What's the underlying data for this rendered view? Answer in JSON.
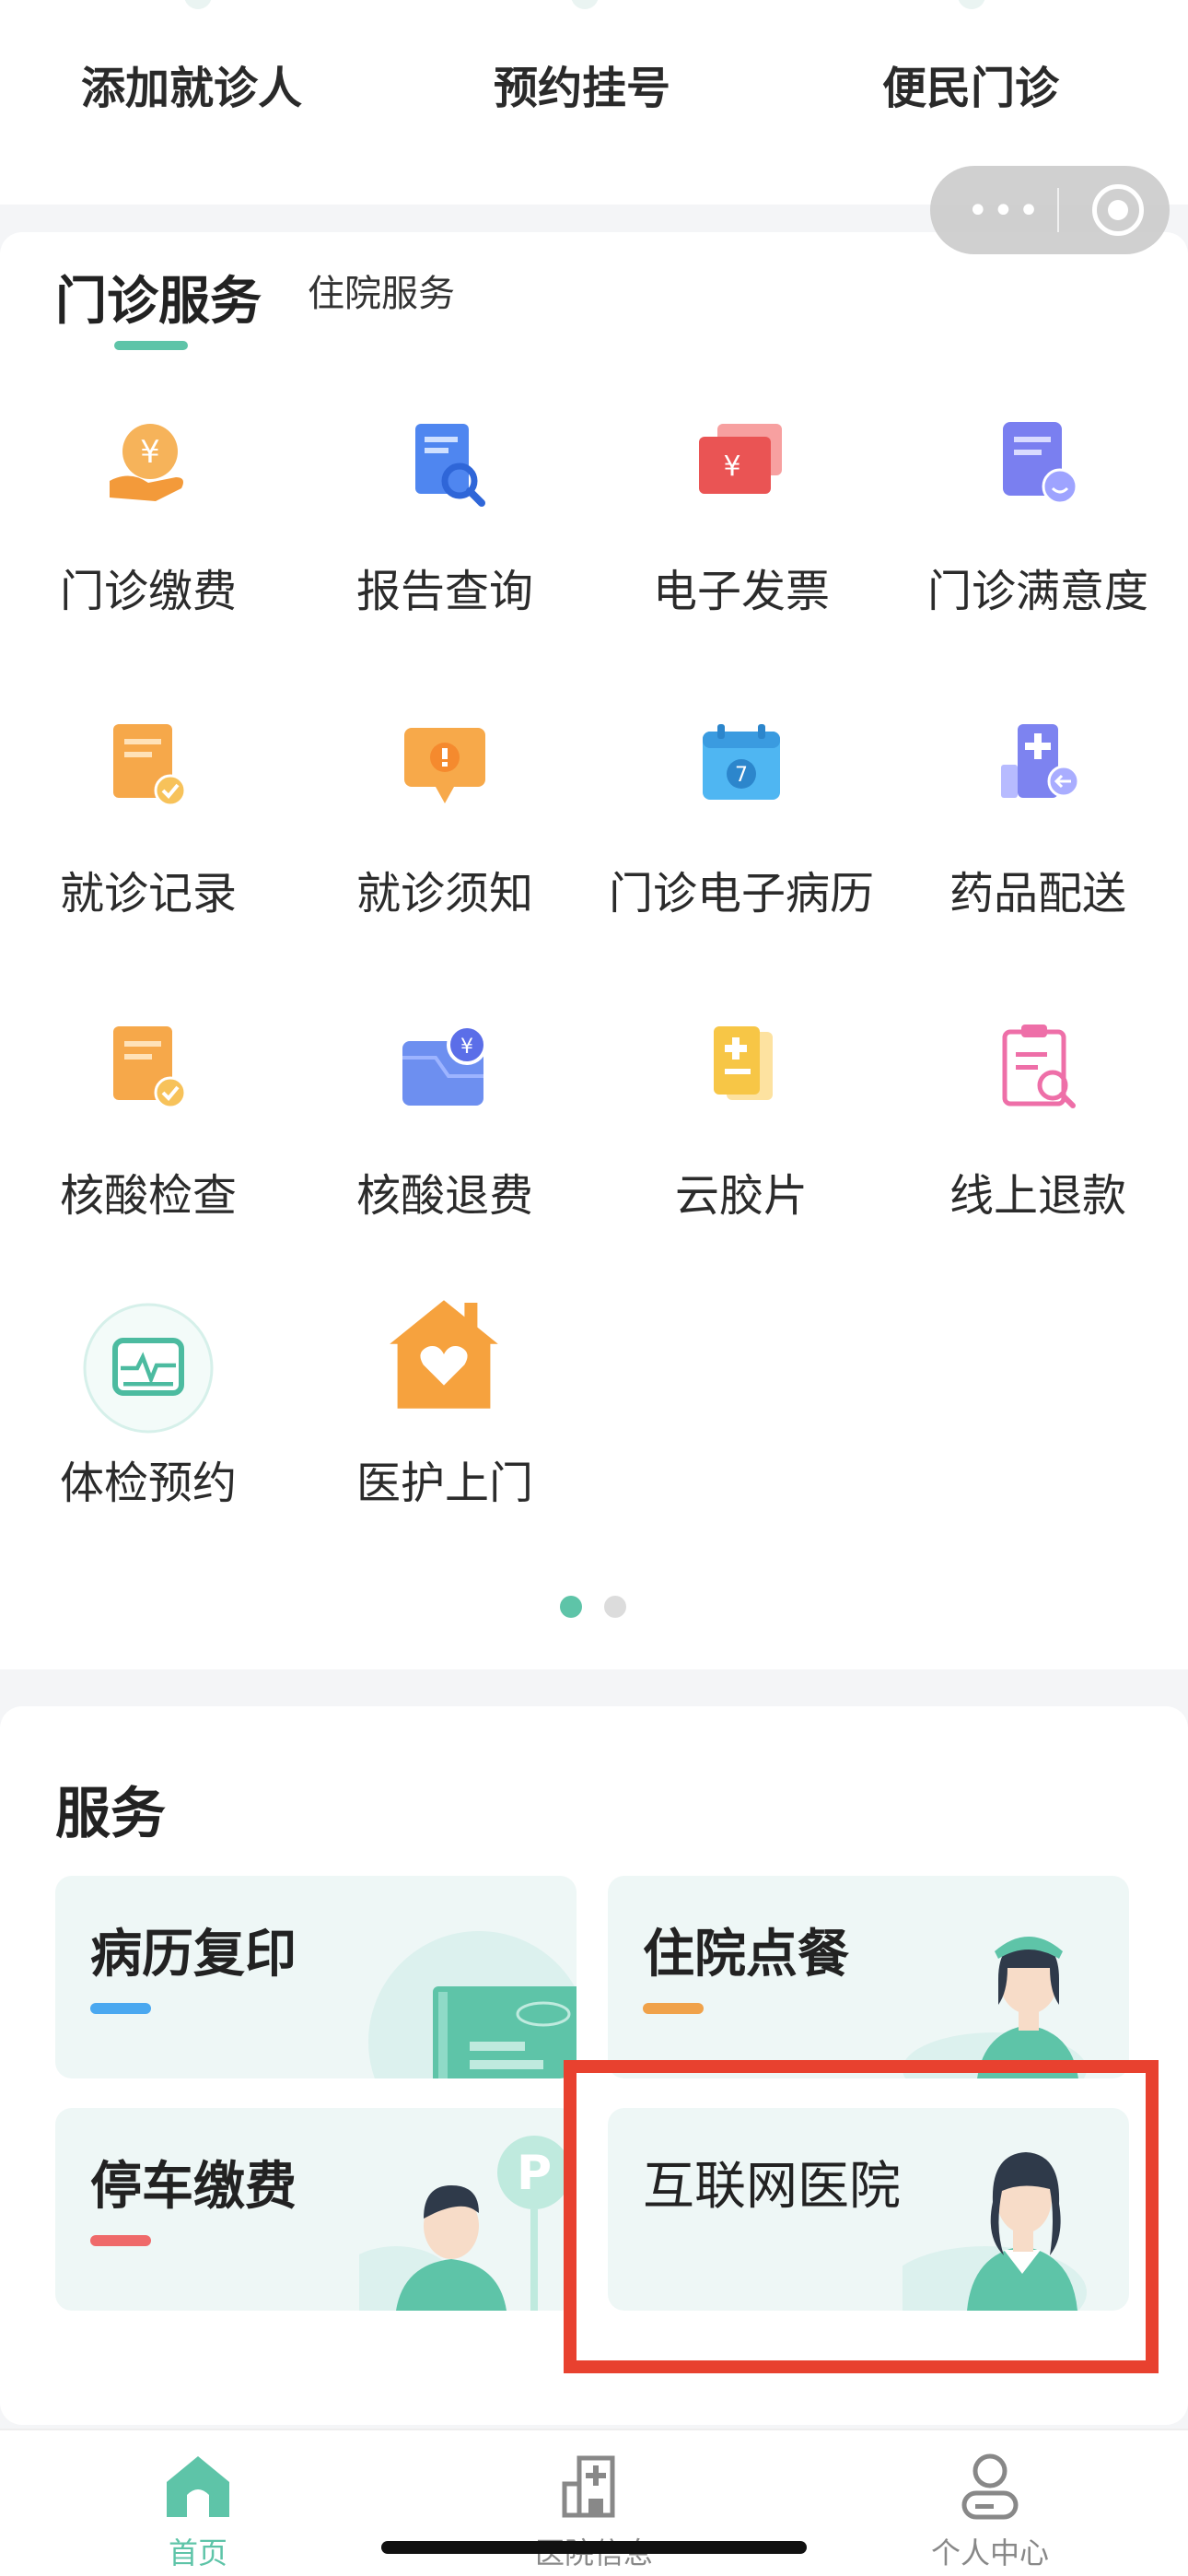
{
  "top_actions": [
    "添加就诊人",
    "预约挂号",
    "便民门诊"
  ],
  "tabs": {
    "active": "门诊服务",
    "inactive": "住院服务"
  },
  "grid": [
    {
      "label": "门诊缴费",
      "icon": "payment-hand-icon"
    },
    {
      "label": "报告查询",
      "icon": "report-search-icon"
    },
    {
      "label": "电子发票",
      "icon": "e-invoice-icon"
    },
    {
      "label": "门诊满意度",
      "icon": "satisfaction-icon"
    },
    {
      "label": "就诊记录",
      "icon": "visit-record-icon"
    },
    {
      "label": "就诊须知",
      "icon": "notice-icon"
    },
    {
      "label": "门诊电子病历",
      "icon": "calendar-record-icon"
    },
    {
      "label": "药品配送",
      "icon": "medicine-delivery-icon"
    },
    {
      "label": "核酸检查",
      "icon": "nucleic-test-icon"
    },
    {
      "label": "核酸退费",
      "icon": "nucleic-refund-icon"
    },
    {
      "label": "云胶片",
      "icon": "cloud-film-icon"
    },
    {
      "label": "线上退款",
      "icon": "online-refund-icon"
    },
    {
      "label": "体检预约",
      "icon": "checkup-icon"
    },
    {
      "label": "医护上门",
      "icon": "home-care-icon"
    }
  ],
  "pager": {
    "current": 1,
    "total": 2
  },
  "services": {
    "title": "服务",
    "items": [
      {
        "label": "病历复印",
        "accent": "#4aa8f0"
      },
      {
        "label": "住院点餐",
        "accent": "#f0a24a"
      },
      {
        "label": "停车缴费",
        "accent": "#ef6a6a"
      },
      {
        "label": "互联网医院",
        "accent": "#5ec4a8"
      }
    ]
  },
  "bottom_nav": [
    {
      "label": "首页",
      "icon": "home-icon",
      "active": true
    },
    {
      "label": "医院信息",
      "icon": "hospital-icon",
      "active": false
    },
    {
      "label": "个人中心",
      "icon": "user-icon",
      "active": false
    }
  ],
  "colors": {
    "accent": "#5ec4a8",
    "highlight": "#e8412f"
  }
}
